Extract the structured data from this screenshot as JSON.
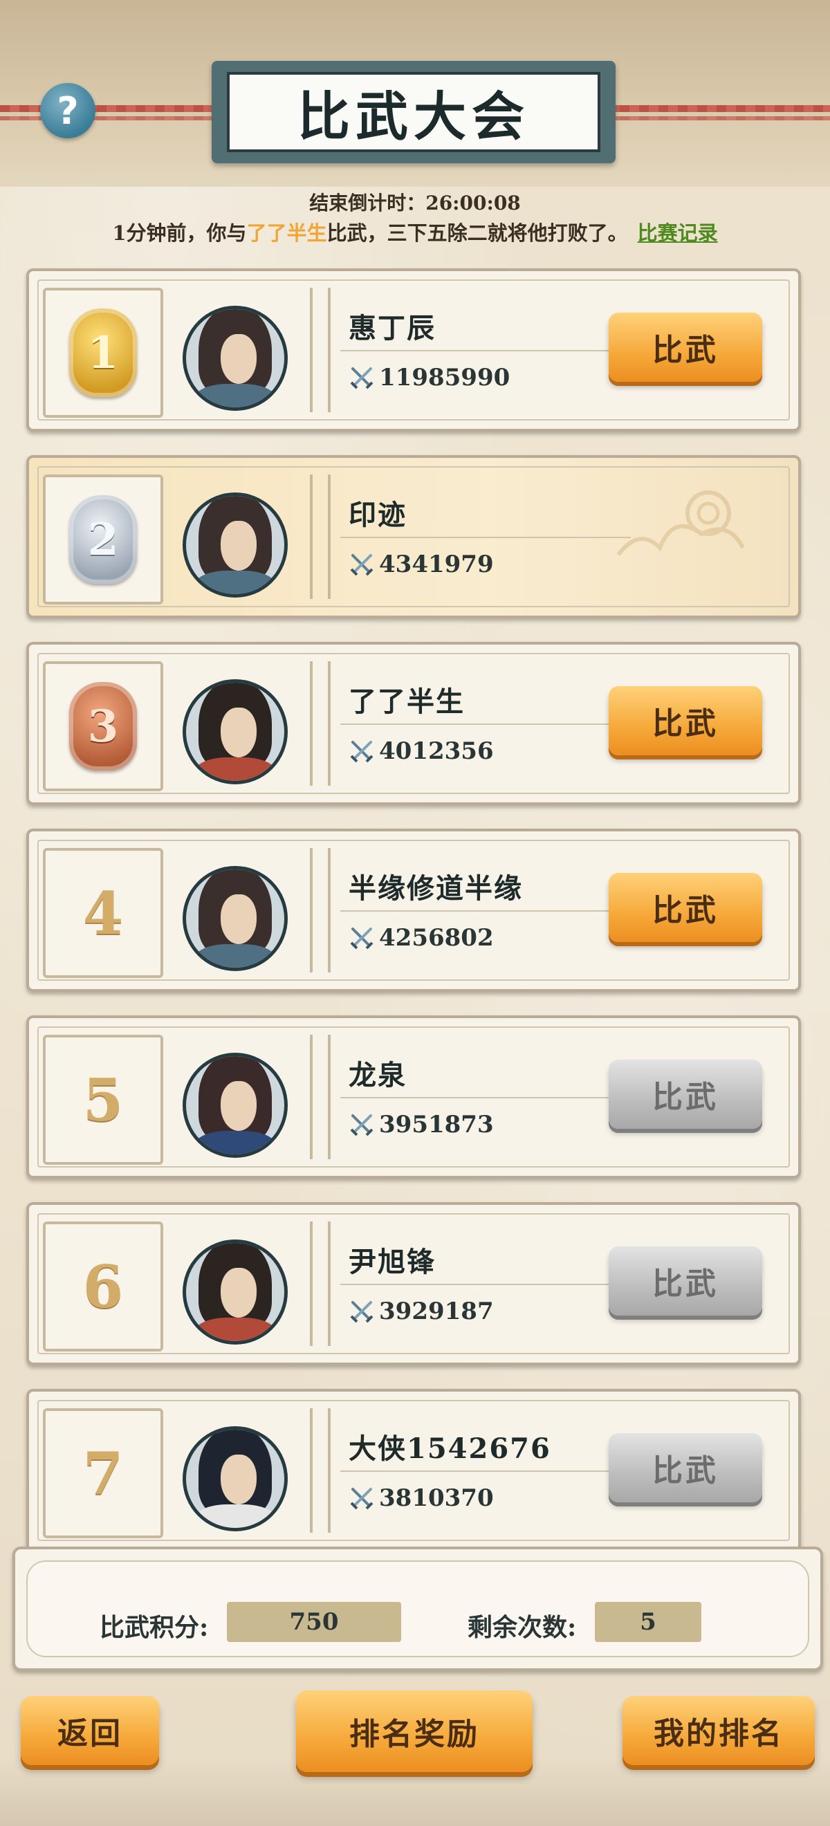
{
  "header": {
    "title": "比武大会",
    "help_glyph": "?",
    "countdown_label": "结束倒计时：",
    "countdown_value": "26:00:08",
    "news_prefix": "1分钟前，你与",
    "news_opponent": "了了半生",
    "news_suffix": "比武，三下五除二就将他打败了。",
    "record_link": "比赛记录"
  },
  "colors": {
    "accent_orange": "#f6a93a",
    "link_green": "#4e8a1e",
    "highlight_name": "#f0a535"
  },
  "rankings": [
    {
      "rank": "1",
      "badge": "gold-medal-icon",
      "name": "惠丁辰",
      "power": "11985990",
      "button": "比武",
      "enabled": true
    },
    {
      "rank": "2",
      "badge": "silver-medal-icon",
      "name": "印迹",
      "power": "4341979",
      "button": "",
      "enabled": false,
      "is_self": true
    },
    {
      "rank": "3",
      "badge": "bronze-medal-icon",
      "name": "了了半生",
      "power": "4012356",
      "button": "比武",
      "enabled": true
    },
    {
      "rank": "4",
      "badge": "",
      "name": "半缘修道半缘",
      "power": "4256802",
      "button": "比武",
      "enabled": true
    },
    {
      "rank": "5",
      "badge": "",
      "name": "龙泉",
      "power": "3951873",
      "button": "比武",
      "enabled": false
    },
    {
      "rank": "6",
      "badge": "",
      "name": "尹旭锋",
      "power": "3929187",
      "button": "比武",
      "enabled": false
    },
    {
      "rank": "7",
      "badge": "",
      "name": "大侠1542676",
      "power": "3810370",
      "button": "比武",
      "enabled": false
    }
  ],
  "stats": {
    "points_label": "比武积分:",
    "points_value": "750",
    "remaining_label": "剩余次数:",
    "remaining_value": "5"
  },
  "footer": {
    "back": "返回",
    "rewards": "排名奖励",
    "my_rank": "我的排名"
  }
}
